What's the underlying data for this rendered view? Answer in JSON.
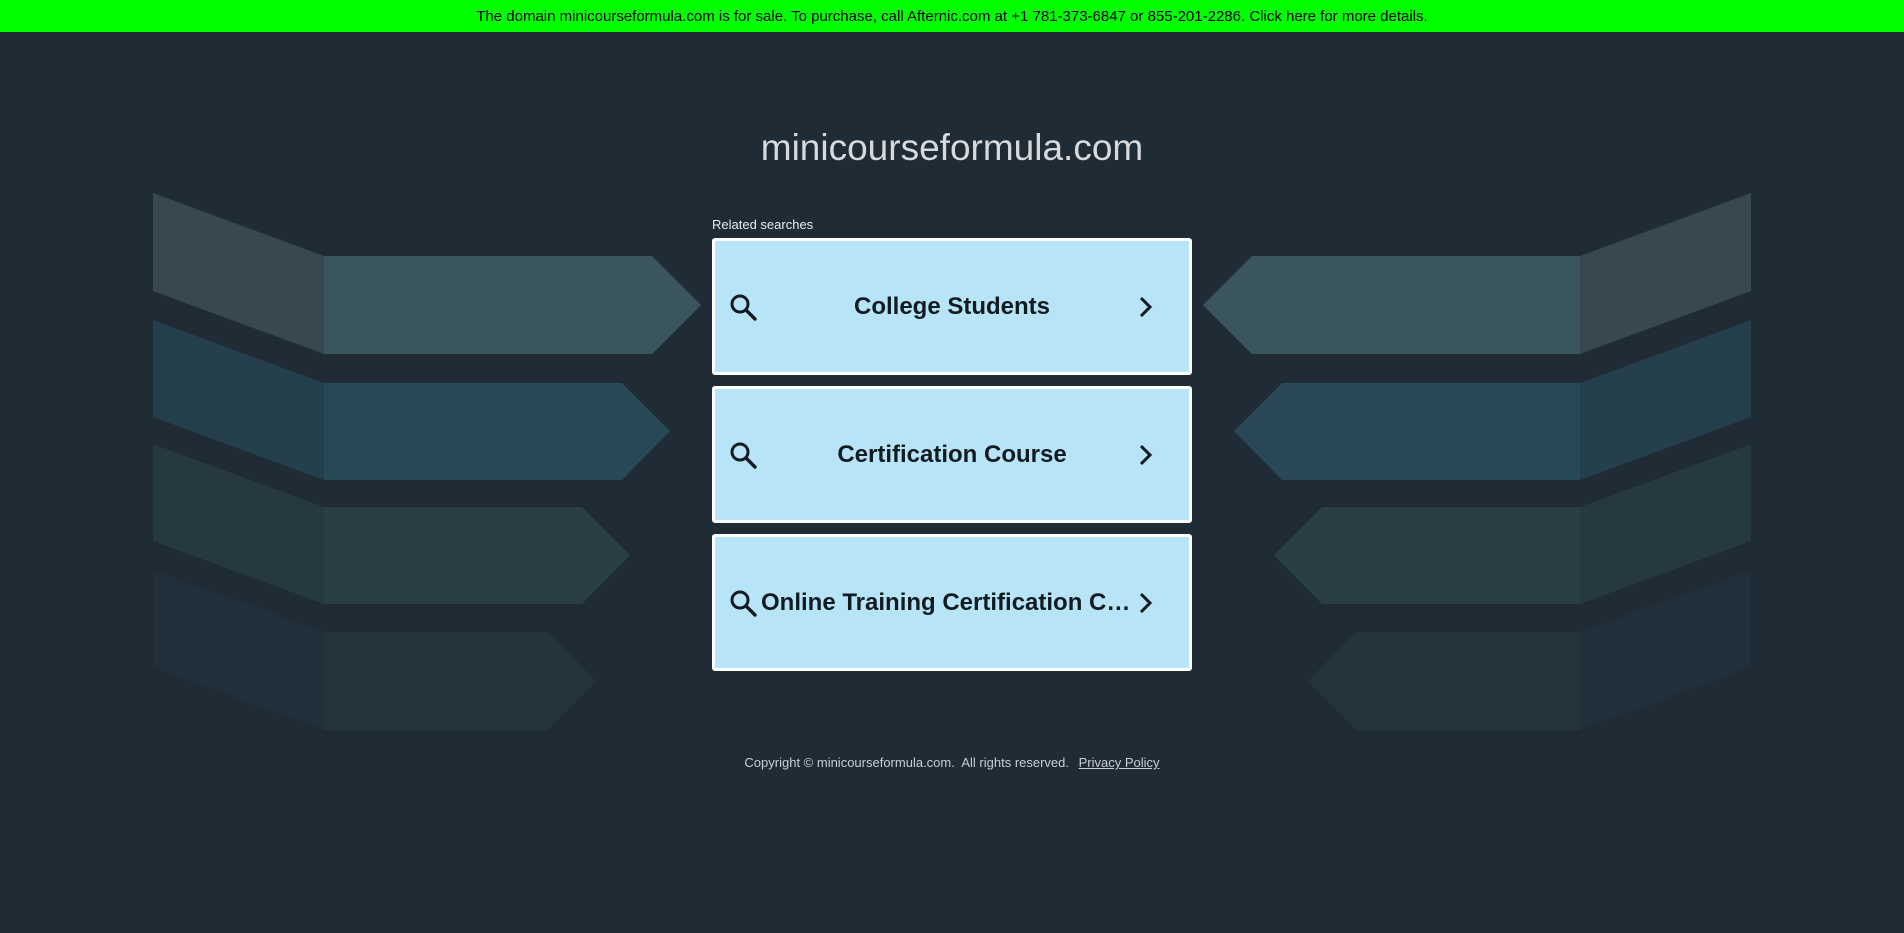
{
  "banner": {
    "text": "The domain minicourseformula.com is for sale. To purchase, call Afternic.com at +1 781-373-6847 or 855-201-2286. Click here for more details.",
    "color": "#00ff00"
  },
  "site": {
    "title": "minicourseformula.com"
  },
  "related": {
    "label": "Related searches",
    "items": [
      {
        "label": "College Students",
        "icon": "search-icon",
        "arrow": "chevron-right-icon"
      },
      {
        "label": "Certification Course",
        "icon": "search-icon",
        "arrow": "chevron-right-icon"
      },
      {
        "label": "Online Training Certification Courses",
        "icon": "search-icon",
        "arrow": "chevron-right-icon"
      }
    ],
    "card_color": "#b8e4f8"
  },
  "footer": {
    "copyright": "Copyright © minicourseformula.com.  All rights reserved.",
    "privacy_label": "Privacy Policy"
  },
  "colors": {
    "background": "#1f2b35"
  }
}
